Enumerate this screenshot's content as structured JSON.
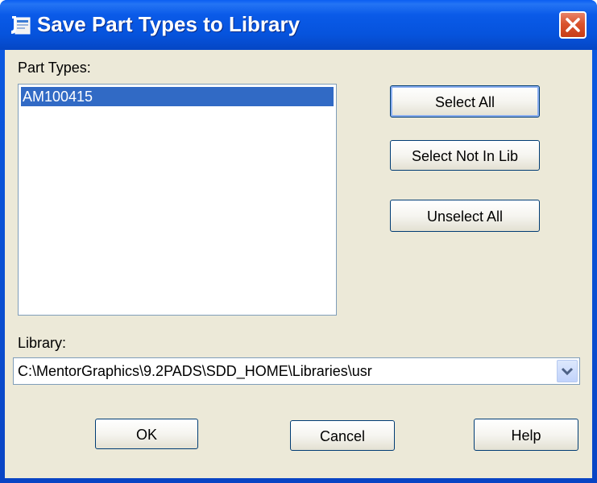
{
  "window": {
    "title": "Save Part Types to Library",
    "app_icon": "part-library-icon",
    "close_icon": "close-icon"
  },
  "part_types": {
    "label": "Part Types:",
    "items": [
      {
        "name": "AM100415",
        "selected": true
      }
    ]
  },
  "buttons": {
    "select_all": "Select All",
    "select_not_in_lib": "Select Not In Lib",
    "unselect_all": "Unselect All",
    "ok": "OK",
    "cancel": "Cancel",
    "help": "Help"
  },
  "library": {
    "label": "Library:",
    "value": "C:\\MentorGraphics\\9.2PADS\\SDD_HOME\\Libraries\\usr",
    "dropdown_icon": "chevron-down-icon"
  },
  "colors": {
    "title_bar": "#0a5ae8",
    "dialog_bg": "#ece9d8",
    "selection": "#316ac5",
    "close_button": "#d9542e"
  }
}
